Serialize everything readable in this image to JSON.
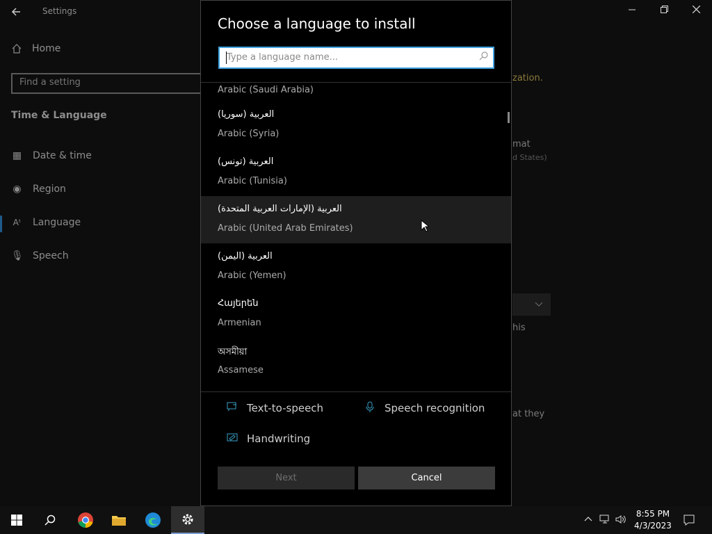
{
  "settings": {
    "title": "Settings",
    "home": "Home",
    "search_placeholder": "Find a setting",
    "section": "Time & Language",
    "nav": [
      {
        "label": "Date & time",
        "icon": "calendar-clock-icon"
      },
      {
        "label": "Region",
        "icon": "globe-icon"
      },
      {
        "label": "Language",
        "icon": "language-icon"
      },
      {
        "label": "Speech",
        "icon": "microphone-icon"
      }
    ],
    "fragments": {
      "f1": "zation.",
      "f2": "mat",
      "f3": "d States)",
      "f4": "his",
      "f5": "at they"
    }
  },
  "dialog": {
    "title": "Choose a language to install",
    "search_placeholder": "Type a language name...",
    "languages": [
      {
        "native": "",
        "english": "Arabic (Saudi Arabia)"
      },
      {
        "native": "العربية (سوريا)",
        "english": "Arabic (Syria)"
      },
      {
        "native": "العربية (تونس)",
        "english": "Arabic (Tunisia)"
      },
      {
        "native": "العربية (الإمارات العربية المتحدة)",
        "english": "Arabic (United Arab Emirates)"
      },
      {
        "native": "العربية (اليمن)",
        "english": "Arabic (Yemen)"
      },
      {
        "native": "Հայերեն",
        "english": "Armenian"
      },
      {
        "native": "অসমীয়া",
        "english": "Assamese"
      }
    ],
    "features": {
      "tts": "Text-to-speech",
      "speech": "Speech recognition",
      "handwriting": "Handwriting"
    },
    "next_label": "Next",
    "cancel_label": "Cancel"
  },
  "taskbar": {
    "time": "8:55 PM",
    "date": "4/3/2023"
  },
  "colors": {
    "accent": "#3fa3e2",
    "feature_icon": "#3aa0c8"
  }
}
